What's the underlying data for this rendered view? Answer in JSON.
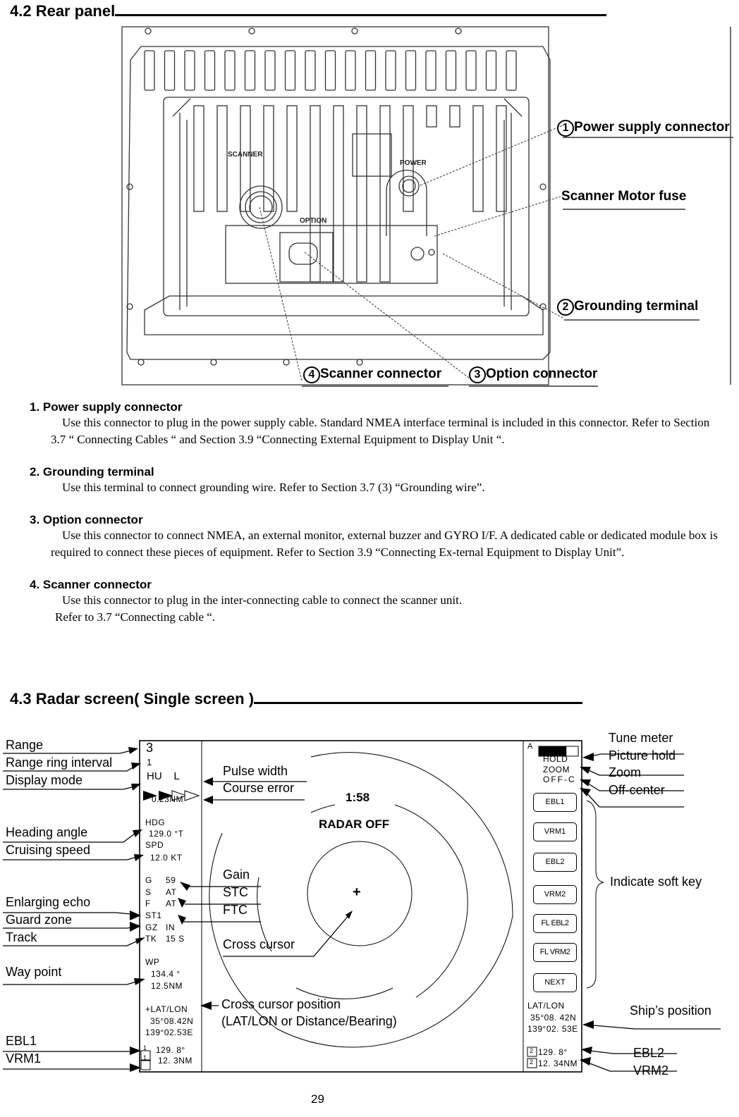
{
  "section_42": {
    "title": "4.2 Rear panel",
    "figure": {
      "panel_labels": {
        "scanner": "SCANNER",
        "power": "POWER",
        "option": "OPTION"
      },
      "callouts": [
        {
          "num": "1",
          "label": "Power supply connector"
        },
        {
          "num": "",
          "label": "Scanner Motor fuse"
        },
        {
          "num": "2",
          "label": "Grounding terminal"
        },
        {
          "num": "4",
          "label": "Scanner connector"
        },
        {
          "num": "3",
          "label": "Option connector"
        }
      ]
    },
    "items": [
      {
        "heading": "1. Power supply connector",
        "text": "Use this connector to plug in the power supply cable. Standard NMEA interface terminal is included in this connector. Refer to Section 3.7 “ Connecting Cables “ and Section 3.9 “Connecting External Equipment to Display Unit “."
      },
      {
        "heading": "2. Grounding terminal",
        "text": "Use this terminal to connect grounding wire. Refer to Section 3.7 (3) “Grounding wire”."
      },
      {
        "heading": "3. Option connector",
        "text": "Use this connector to connect NMEA, an external monitor, external buzzer and GYRO I/F. A dedicated cable or dedicated module box is required to connect these pieces of equipment.   Refer to Section 3.9 “Connecting Ex-ternal Equipment to Display Unit”."
      },
      {
        "heading": "4. Scanner connector",
        "text": "Use this connector to plug in the inter-connecting cable to connect the scanner unit.",
        "text2": "Refer to 3.7 “Connecting cable “."
      }
    ]
  },
  "section_43": {
    "title": "4.3 Radar screen( Single screen )",
    "screen": {
      "range": "3",
      "ring_interval": "1",
      "display_mode": "HU    L",
      "pulse_value": "0.23NM",
      "hdg_label": "HDG",
      "hdg_value": "129.0 °T",
      "spd_label": "SPD",
      "spd_value": "12.0 KT",
      "gain": [
        "G",
        "59"
      ],
      "stc": [
        "S",
        "AT"
      ],
      "ftc": [
        "F",
        "AT"
      ],
      "st": [
        "ST1",
        ""
      ],
      "gz": [
        "GZ",
        "IN"
      ],
      "tk": [
        "TK",
        "15 S"
      ],
      "wp_label": "WP",
      "wp_bearing": "134.4 °",
      "wp_distance": "12.5NM",
      "cursor_label": "+LAT/LON",
      "cursor_lat": "35°08.42N",
      "cursor_lon": "139°02.53E",
      "ebl1_num": "1",
      "ebl1_value": "129. 8°",
      "vrm1_num": "1",
      "vrm1_value": "12. 3NM",
      "timer": "1:58",
      "status": "RADAR OFF",
      "cross": "+",
      "tune_label": "A",
      "tune_level": 0.7,
      "hold": "HOLD",
      "zoom": "ZOOM",
      "offc": "OFF-C",
      "softkeys": [
        "EBL1",
        "VRM1",
        "EBL2",
        "VRM2",
        "FL EBL2",
        "FL VRM2",
        "NEXT"
      ],
      "ship_label": "LAT/LON",
      "ship_lat": "35°08. 42N",
      "ship_lon": "139°02. 53E",
      "ebl2_num": "2",
      "ebl2_value": "129. 8°",
      "vrm2_num": "2",
      "vrm2_value": "12. 34NM"
    },
    "annotations": {
      "left": [
        "Range",
        "Range ring interval",
        "Display mode",
        "Heading angle",
        "Cruising speed",
        "Enlarging echo",
        "Guard zone",
        "Track",
        "Way point",
        "EBL1",
        "VRM1"
      ],
      "inner": [
        "Pulse width",
        "Course error",
        "Gain",
        "STC",
        "FTC",
        "Cross cursor",
        "Cross cursor position",
        "(LAT/LON or Distance/Bearing)"
      ],
      "right": [
        "Tune meter",
        "Picture hold",
        "Zoom",
        "Off-center",
        "Indicate soft key",
        "Ship’s position",
        "EBL2",
        "VRM2"
      ]
    }
  },
  "page_number": "29"
}
